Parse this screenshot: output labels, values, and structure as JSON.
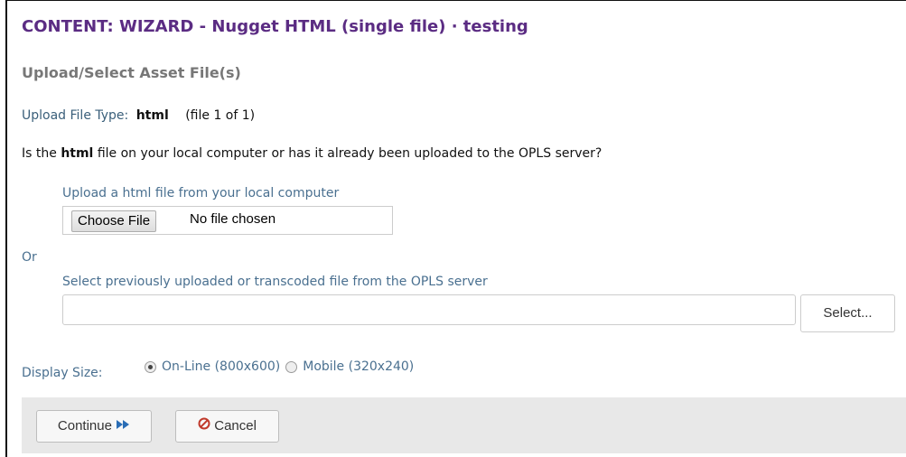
{
  "header": {
    "title": "CONTENT: WIZARD - Nugget HTML (single file) · testing",
    "subtitle": "Upload/Select Asset File(s)"
  },
  "file_type": {
    "label": "Upload File Type:",
    "value": "html",
    "note": "(file 1 of 1)"
  },
  "question": {
    "prefix": "Is the",
    "emphasis": "html",
    "suffix": "file on your local computer or has it already been uploaded to the OPLS server?"
  },
  "upload": {
    "label": "Upload a html file from your local computer",
    "choose_button": "Choose File",
    "status": "No file chosen"
  },
  "or_text": "Or",
  "select": {
    "label": "Select previously uploaded or transcoded file from the OPLS server",
    "value": "",
    "button": "Select..."
  },
  "display_size": {
    "label": "Display Size:",
    "options": [
      {
        "label": "On-Line (800x600)",
        "checked": true
      },
      {
        "label": "Mobile (320x240)",
        "checked": false
      }
    ]
  },
  "footer": {
    "continue_label": "Continue",
    "cancel_label": "Cancel"
  },
  "colors": {
    "title": "#5b2c83",
    "label_blue": "#4a7090",
    "footer_bg": "#e8e8e8",
    "cancel_icon": "#c0392b",
    "continue_icon": "#2a6db5"
  }
}
